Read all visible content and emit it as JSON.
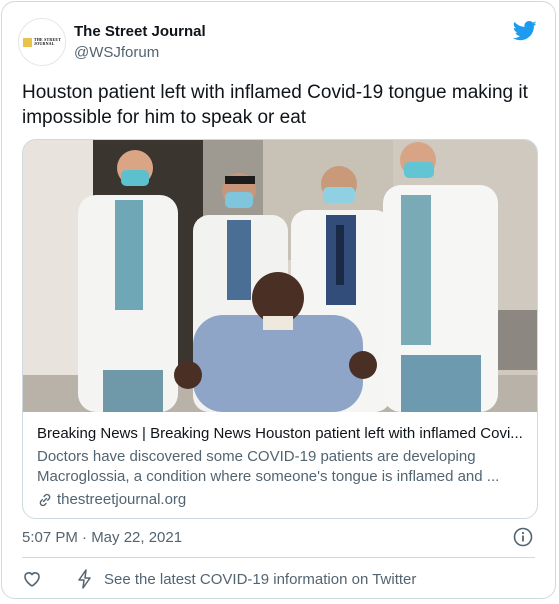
{
  "author": {
    "name": "The Street Journal",
    "handle": "@WSJforum",
    "logo_text": "THE STREET JOURNAL"
  },
  "tweet": {
    "text": "Houston patient left with inflamed Covid-19 tongue making it impossible for him to speak or eat",
    "timestamp": "5:07 PM · May 22, 2021"
  },
  "card": {
    "title": "Breaking News | Breaking News Houston patient left with inflamed Covi...",
    "description": "Doctors have discovered some COVID-19 patients are developing Macroglossia, a condition where someone's tongue is inflamed and ...",
    "link": "thestreetjournal.org"
  },
  "footer": {
    "covid_info": "See the latest COVID-19 information on Twitter"
  },
  "icons": {
    "twitter": "twitter-bird-icon",
    "info": "info-icon",
    "heart": "heart-icon",
    "bolt": "bolt-icon",
    "link": "link-icon"
  },
  "colors": {
    "twitter_blue": "#1d9bf0",
    "secondary_text": "#536471",
    "border": "#cfd9de"
  }
}
